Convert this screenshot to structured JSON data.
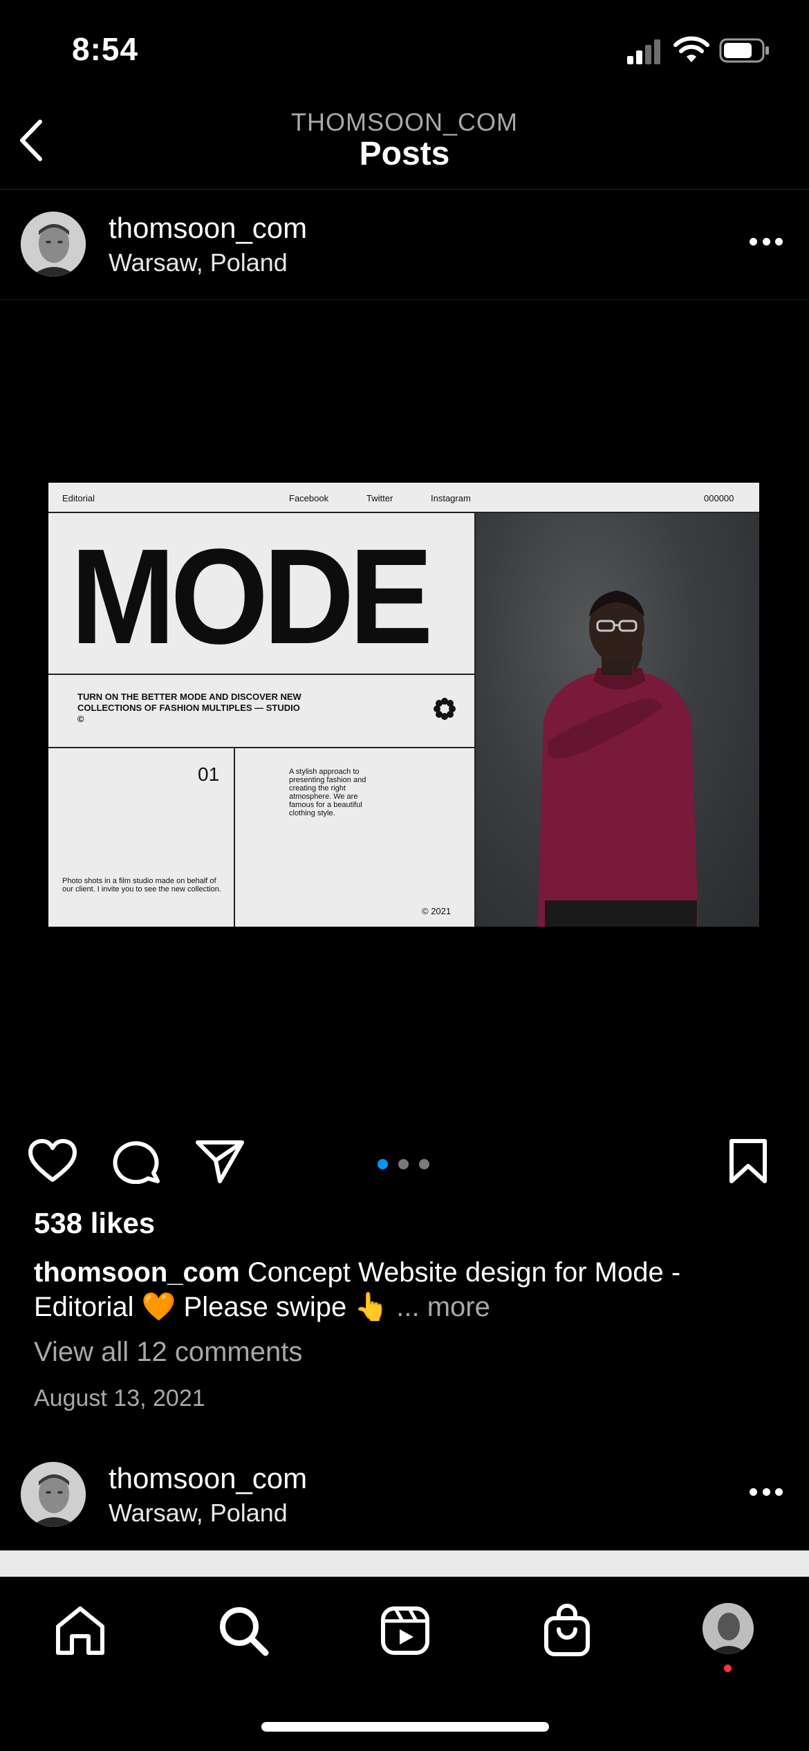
{
  "status": {
    "time": "8:54"
  },
  "header": {
    "subtitle": "THOMSOON_COM",
    "title": "Posts"
  },
  "post": {
    "username": "thomsoon_com",
    "location": "Warsaw, Poland",
    "media": {
      "nav_left": "Editorial",
      "nav_links": [
        "Facebook",
        "Twitter",
        "Instagram"
      ],
      "nav_right": "000000",
      "headline": "MODE",
      "tagline": "TURN ON THE BETTER MODE AND DISCOVER NEW COLLECTIONS OF FASHION MULTIPLES — STUDIO ©",
      "number": "01",
      "description": "A stylish approach to presenting fashion and creating the right atmosphere. We are famous for a beautiful clothing style.",
      "note": "Photo shots in a film studio made on behalf of our client. I invite you to see the new collection.",
      "copyright": "© 2021"
    },
    "carousel": {
      "count": 3,
      "active_index": 0,
      "active_color": "#0095f6"
    },
    "likes": "538 likes",
    "caption_user": "thomsoon_com",
    "caption_text": " Concept Website design for Mode - Editorial 🧡 Please swipe 👆",
    "caption_more": " ... more",
    "view_comments": "View all 12 comments",
    "date": "August 13, 2021"
  },
  "next_post": {
    "username": "thomsoon_com",
    "location": "Warsaw, Poland"
  },
  "tabbar": {
    "items": [
      "home-icon",
      "search-icon",
      "reels-icon",
      "shop-icon",
      "profile-avatar"
    ],
    "notification_color": "#ff3040"
  },
  "icons": [
    "back-icon",
    "more-icon",
    "heart-icon",
    "comment-icon",
    "share-icon",
    "bookmark-icon"
  ]
}
